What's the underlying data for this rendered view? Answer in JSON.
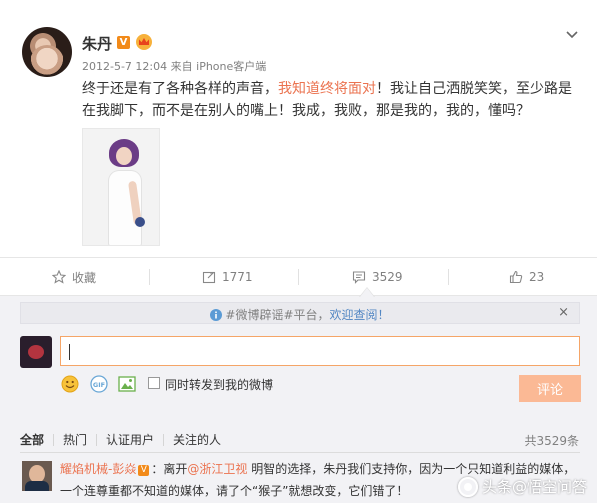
{
  "post": {
    "author": "朱丹",
    "verified_badge": "V",
    "crown_icon": "vip-crown-icon",
    "time": "2012-5-7 12:04",
    "source_prefix": "来自",
    "source": "iPhone客户端",
    "text_before": "终于还是有了各种各样的声音，",
    "text_highlight": "我知道终将面对",
    "text_after": "！我让自己洒脱笑笑，至少路是在我脚下，而不是在别人的嘴上！我成，我败，那是我的，我的，懂吗？"
  },
  "actions": {
    "favorite_label": "收藏",
    "repost_count": "1771",
    "comment_count": "3529",
    "like_count": "23"
  },
  "notice": {
    "hashtag": "#微博辟谣#平台，",
    "welcome": "欢迎查阅！",
    "close": "×"
  },
  "composer": {
    "emoji_icon": "emoji-icon",
    "gif_icon": "gif-icon",
    "image_icon": "image-icon",
    "forward_label": "同时转发到我的微博",
    "submit_label": "评论"
  },
  "filters": {
    "items": [
      "全部",
      "热门",
      "认证用户",
      "关注的人"
    ],
    "total": "共3529条"
  },
  "comment": {
    "user": "耀焰机械-彭焱",
    "badge": "V",
    "colon": "：离开",
    "mention": "@浙江卫视",
    "text": " 明智的选择，朱丹我们支持你，因为一个只知道利益的媒体，一个连尊重都不知道的媒体，请了个“猴子”就想改变，它们错了！"
  },
  "watermark": "头条@悟空问答",
  "colors": {
    "accent": "#eb7350",
    "link": "#5387c3",
    "submit_bg": "#fbb995",
    "panel_bg": "#f2f2f5"
  }
}
